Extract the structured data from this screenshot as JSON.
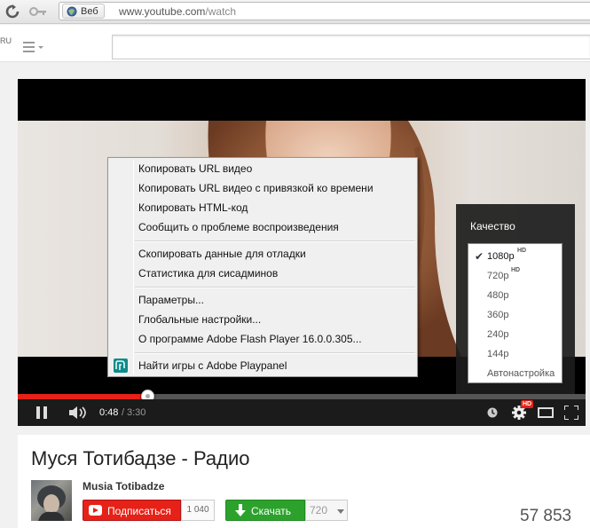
{
  "browser": {
    "web_label": "Веб",
    "url_host": "www.youtube.com",
    "url_path": "/watch"
  },
  "header": {
    "locale": "RU",
    "search_placeholder": ""
  },
  "player": {
    "time_current": "0:48",
    "time_separator": "/",
    "time_duration": "3:30",
    "progress_fraction": 0.229,
    "hd_badge": "HD"
  },
  "quality_menu": {
    "title": "Качество",
    "options": [
      {
        "label": "1080p",
        "hd": "HD",
        "selected": true
      },
      {
        "label": "720p",
        "hd": "HD",
        "selected": false
      },
      {
        "label": "480p",
        "hd": "",
        "selected": false
      },
      {
        "label": "360p",
        "hd": "",
        "selected": false
      },
      {
        "label": "240p",
        "hd": "",
        "selected": false
      },
      {
        "label": "144p",
        "hd": "",
        "selected": false
      },
      {
        "label": "Автонастройка",
        "hd": "",
        "selected": false
      }
    ]
  },
  "context_menu": {
    "items": [
      "Копировать URL видео",
      "Копировать URL видео с привязкой ко времени",
      "Копировать HTML-код",
      "Сообщить о проблеме воспроизведения",
      "Скопировать данные для отладки",
      "Статистика для сисадминов",
      "Параметры...",
      "Глобальные настройки...",
      "О программе Adobe Flash Player 16.0.0.305...",
      "Найти игры с Adobe Playpanel"
    ]
  },
  "video": {
    "title": "Муся Тотибадзе - Радио",
    "channel": "Musia Totibadze",
    "subscribe_label": "Подписаться",
    "subscriber_count": "1 040",
    "download_label": "Скачать",
    "download_quality": "720",
    "views": "57 853"
  },
  "colors": {
    "youtube_red": "#e62117",
    "download_green": "#2ca22c"
  }
}
